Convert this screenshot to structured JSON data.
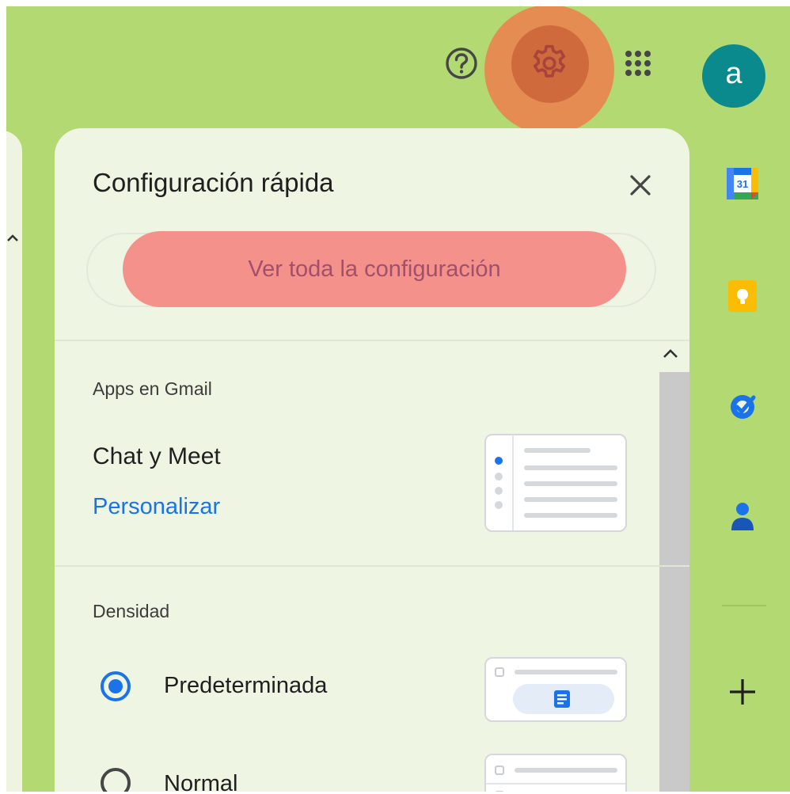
{
  "quick_settings": {
    "title": "Configuración rápida",
    "see_all_button": "Ver toda la configuración",
    "apps_section": {
      "heading": "Apps en Gmail",
      "item": "Chat y Meet",
      "link": "Personalizar"
    },
    "density_section": {
      "heading": "Densidad",
      "options": [
        {
          "label": "Predeterminada",
          "selected": true
        },
        {
          "label": "Normal",
          "selected": false
        }
      ]
    }
  },
  "header": {
    "avatar_letter": "a",
    "icons": [
      "help-icon",
      "gear-icon",
      "apps-grid-icon"
    ]
  },
  "side_panel": {
    "icons": [
      "calendar-icon",
      "keep-icon",
      "tasks-icon",
      "contacts-icon",
      "add-icon"
    ],
    "calendar_day": "31"
  },
  "colors": {
    "accent": "#1a73e8",
    "background": "#b3d972",
    "panel": "#eef5e2",
    "highlight_orange": "#e8854f",
    "highlight_pink": "#f4918a"
  }
}
